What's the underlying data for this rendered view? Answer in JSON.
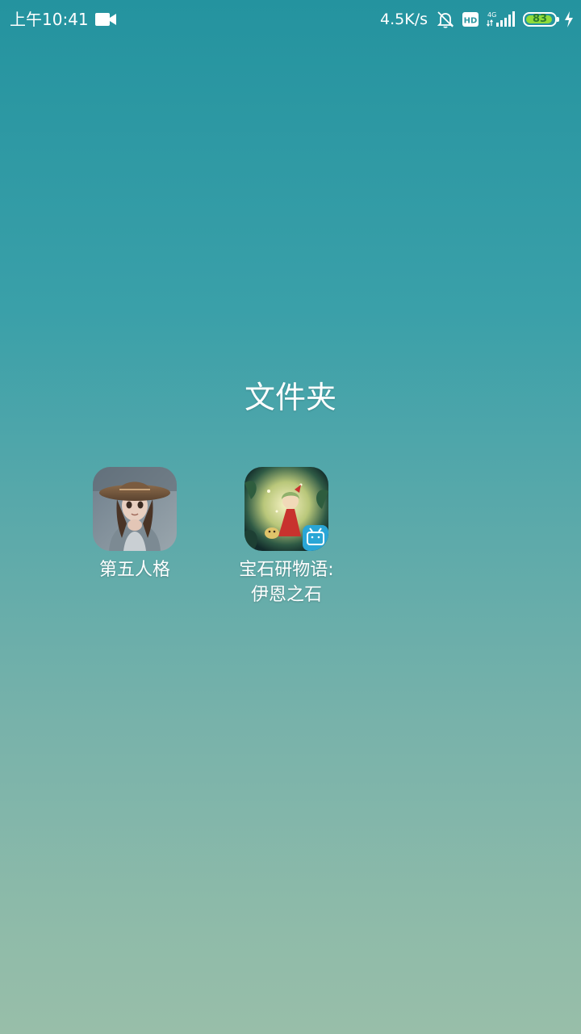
{
  "status_bar": {
    "time": "上午10:41",
    "net_speed": "4.5K/s",
    "battery_level": "83",
    "battery_color": "#8fdc3a",
    "icons": [
      "video-camera-icon",
      "bell-off-icon",
      "hd-icon",
      "signal-4g-icon",
      "battery-icon",
      "charging-bolt-icon"
    ]
  },
  "folder": {
    "title": "文件夹",
    "apps": [
      {
        "name_line1": "第五人格",
        "name_line2": "",
        "icon": "identity-v-app-icon"
      },
      {
        "name_line1": "宝石研物语:",
        "name_line2": "伊恩之石",
        "icon": "gem-story-app-icon"
      }
    ]
  },
  "colors": {
    "background_top": "#24939f",
    "background_bottom": "#98bea9",
    "text": "#ffffff"
  }
}
